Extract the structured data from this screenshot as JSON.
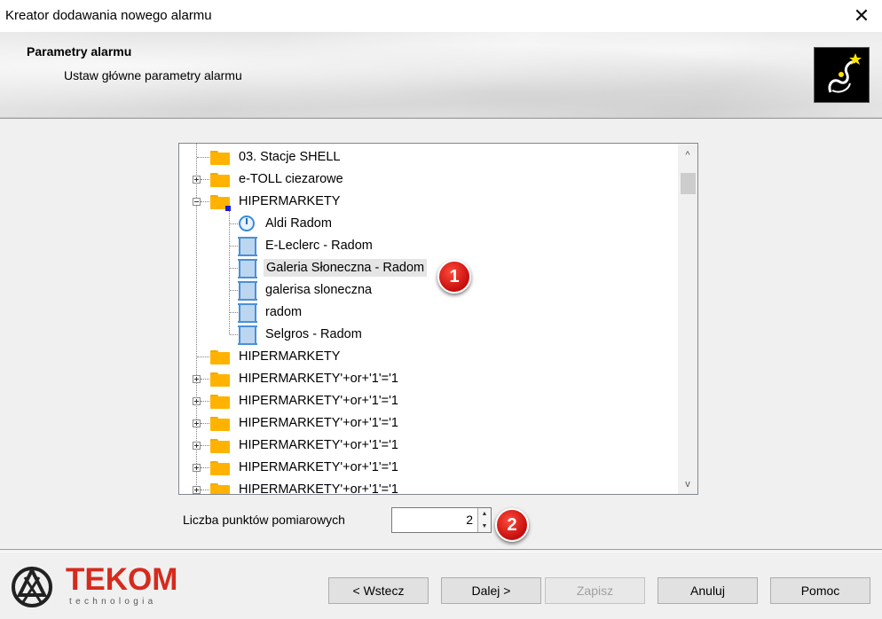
{
  "window": {
    "title": "Kreator dodawania nowego alarmu",
    "close_glyph": "✕"
  },
  "header": {
    "title": "Parametry alarmu",
    "subtitle": "Ustaw główne parametry alarmu",
    "icon": "wizard-icon"
  },
  "tree": {
    "items": [
      {
        "label": "03. Stacje SHELL",
        "icon": "folder-icon",
        "level": 0,
        "expander": "none"
      },
      {
        "label": "e-TOLL ciezarowe",
        "icon": "folder-icon",
        "level": 0,
        "expander": "plus"
      },
      {
        "label": "HIPERMARKETY",
        "icon": "folder-icon",
        "level": 0,
        "expander": "minus"
      },
      {
        "label": "Aldi Radom",
        "icon": "gauge-icon",
        "level": 1
      },
      {
        "label": "E-Leclerc - Radom",
        "icon": "measurement-point-icon",
        "level": 1
      },
      {
        "label": "Galeria Słoneczna - Radom",
        "icon": "measurement-point-icon",
        "level": 1,
        "selected": true
      },
      {
        "label": "galerisa sloneczna",
        "icon": "measurement-point-icon",
        "level": 1
      },
      {
        "label": "radom",
        "icon": "measurement-point-icon",
        "level": 1
      },
      {
        "label": "Selgros - Radom",
        "icon": "measurement-point-icon",
        "level": 1
      },
      {
        "label": "HIPERMARKETY",
        "icon": "folder-icon",
        "level": 0,
        "expander": "none"
      },
      {
        "label": "HIPERMARKETY'+or+'1'='1",
        "icon": "folder-icon",
        "level": 0,
        "expander": "plus"
      },
      {
        "label": "HIPERMARKETY'+or+'1'='1",
        "icon": "folder-icon",
        "level": 0,
        "expander": "plus"
      },
      {
        "label": "HIPERMARKETY'+or+'1'='1",
        "icon": "folder-icon",
        "level": 0,
        "expander": "plus"
      },
      {
        "label": "HIPERMARKETY'+or+'1'='1",
        "icon": "folder-icon",
        "level": 0,
        "expander": "plus"
      },
      {
        "label": "HIPERMARKETY'+or+'1'='1",
        "icon": "folder-icon",
        "level": 0,
        "expander": "plus"
      },
      {
        "label": "HIPERMARKETY'+or+'1'='1",
        "icon": "folder-icon",
        "level": 0,
        "expander": "plus"
      }
    ],
    "scroll_up": "^",
    "scroll_down": "v"
  },
  "points": {
    "label": "Liczba punktów pomiarowych",
    "value": "2"
  },
  "annotations": [
    {
      "label": "1"
    },
    {
      "label": "2"
    }
  ],
  "footer": {
    "brand": "TEKOM",
    "brand_sub": "technologia",
    "brand_color": "#d52b1e",
    "buttons": [
      {
        "label": "< Wstecz",
        "enabled": true
      },
      {
        "label": "Dalej >",
        "enabled": true
      },
      {
        "label": "Zapisz",
        "enabled": false
      },
      {
        "label": "Anuluj",
        "enabled": true
      },
      {
        "label": "Pomoc",
        "enabled": true
      }
    ]
  }
}
